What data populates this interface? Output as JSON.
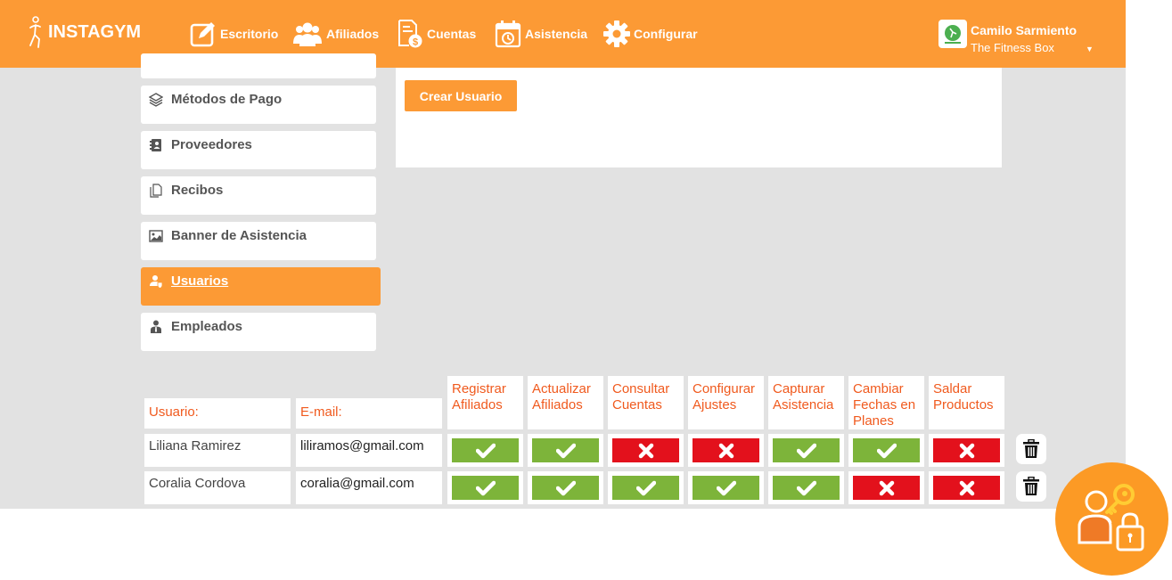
{
  "brand": {
    "name": "INSTAGYM"
  },
  "nav": [
    {
      "label": "Escritorio",
      "icon": "edit-icon"
    },
    {
      "label": "Afiliados",
      "icon": "users-icon"
    },
    {
      "label": "Cuentas",
      "icon": "invoice-icon"
    },
    {
      "label": "Asistencia",
      "icon": "calendar-icon"
    },
    {
      "label": "Configurar",
      "icon": "gear-icon"
    }
  ],
  "user": {
    "name": "Camilo Sarmiento",
    "gym": "The Fitness Box",
    "caret": "▼"
  },
  "sidebar": {
    "items": [
      {
        "label": "Métodos de Pago",
        "icon": "layers-icon"
      },
      {
        "label": "Proveedores",
        "icon": "address-book-icon"
      },
      {
        "label": "Recibos",
        "icon": "documents-icon"
      },
      {
        "label": "Banner de Asistencia",
        "icon": "image-icon"
      },
      {
        "label": "Usuarios",
        "icon": "user-shield-icon",
        "active": true
      },
      {
        "label": "Empleados",
        "icon": "employee-icon"
      }
    ]
  },
  "panel": {
    "create_button": "Crear Usuario"
  },
  "table": {
    "headers": {
      "user": "Usuario:",
      "email": "E-mail:",
      "perms": [
        "Registrar Afiliados",
        "Actualizar Afiliados",
        "Consultar Cuentas",
        "Configurar Ajustes",
        "Capturar Asistencia",
        "Cambiar Fechas en Planes",
        "Saldar Productos"
      ]
    },
    "rows": [
      {
        "name": "Liliana Ramirez",
        "email": "liliramos@gmail.com",
        "perms": [
          true,
          true,
          false,
          false,
          true,
          true,
          false
        ]
      },
      {
        "name": "Coralia Cordova",
        "email": "coralia@gmail.com",
        "perms": [
          true,
          true,
          true,
          true,
          true,
          false,
          false
        ]
      }
    ]
  },
  "colors": {
    "accent": "#fc9a35",
    "allowed": "#7db43a",
    "denied": "#e3111c",
    "header_text": "#f05a1e"
  }
}
